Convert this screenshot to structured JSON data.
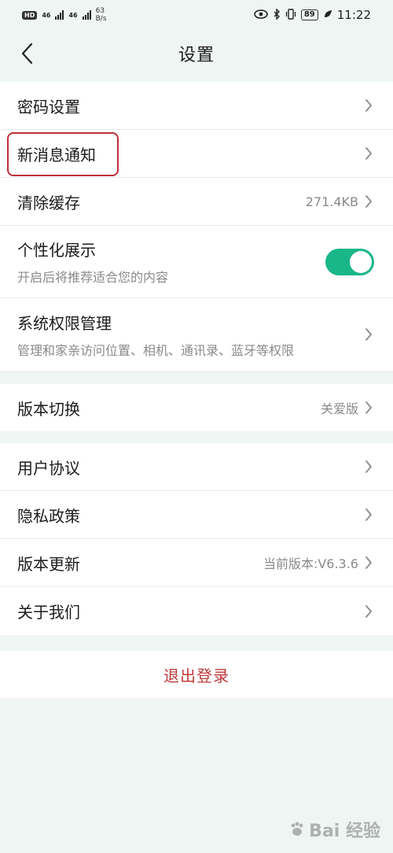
{
  "status_bar": {
    "network_left": "46",
    "network_right": "46",
    "net_speed_value": "63",
    "net_speed_unit": "B/s",
    "battery": "89",
    "time": "11:22"
  },
  "header": {
    "title": "设置"
  },
  "group1": {
    "items": [
      {
        "label": "密码设置"
      },
      {
        "label": "新消息通知"
      },
      {
        "label": "清除缓存",
        "value": "271.4KB"
      },
      {
        "label": "个性化展示",
        "sub": "开启后将推荐适合您的内容",
        "toggle": true
      },
      {
        "label": "系统权限管理",
        "sub": "管理和家亲访问位置、相机、通讯录、蓝牙等权限"
      }
    ]
  },
  "group2": {
    "items": [
      {
        "label": "版本切换",
        "value": "关爱版"
      }
    ]
  },
  "group3": {
    "items": [
      {
        "label": "用户协议"
      },
      {
        "label": "隐私政策"
      },
      {
        "label": "版本更新",
        "value": "当前版本:V6.3.6"
      },
      {
        "label": "关于我们"
      }
    ]
  },
  "logout": {
    "label": "退出登录"
  },
  "watermark": {
    "text": "Bai 经验"
  },
  "colors": {
    "accent": "#19b68a",
    "logout": "#c0393b",
    "highlight": "#c0303a",
    "background": "#eef5f3"
  }
}
